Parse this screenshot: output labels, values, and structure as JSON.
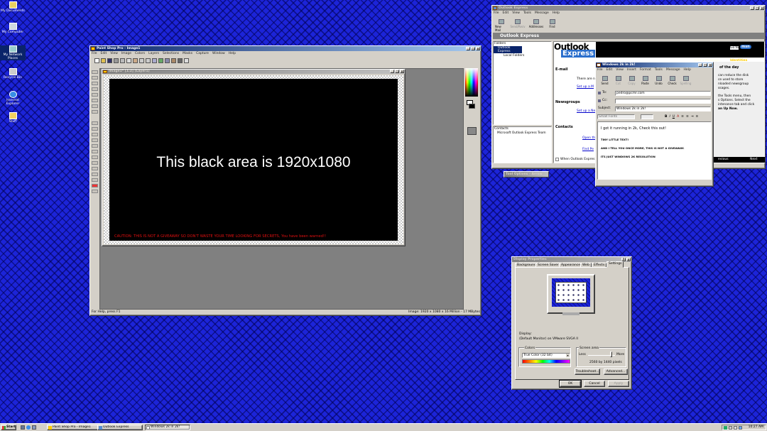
{
  "desktop": {
    "icons": [
      "My Documents",
      "My Computer",
      "My Network Places",
      "Recycle Bin",
      "Internet Explorer",
      "Stuff"
    ]
  },
  "psp": {
    "title": "Paint Shop Pro - Image1",
    "menu": [
      "File",
      "Edit",
      "View",
      "Image",
      "Colors",
      "Layers",
      "Selections",
      "Masks",
      "Capture",
      "Window",
      "Help"
    ],
    "doc_title": "Image1* [1:2] (Layer1)",
    "canvas_text": "This black area is 1920x1080",
    "warning": "CAUTION: THIS IS NOT A GIVEAWAY SO DON'T WASTE YOUR TIME LOOKING FOR SECRETS, You have been warned!!",
    "status_left": "For Help, press F1",
    "status_right": "Image: 1920 x 1080 x 16 Million - 17 MBytes"
  },
  "oe": {
    "title": "Outlook Express",
    "menu": [
      "File",
      "Edit",
      "View",
      "Tools",
      "Message",
      "Help"
    ],
    "toolbar": [
      "New Mail",
      "Send/Recv",
      "Addresses",
      "Find"
    ],
    "header": "Outlook Express",
    "folders_label": "Folders",
    "folders": [
      "Outlook Express",
      "Local Folders"
    ],
    "contacts_label": "Contacts",
    "contacts": [
      "Microsoft Outlook Express Team"
    ],
    "logo1": "Outlook",
    "logo2": "Express",
    "goto": "Go to",
    "msn": "msn",
    "email_h": "E-mail",
    "email_1": "There are n",
    "email_2": "Set up a M",
    "news_h": "Newsgroups",
    "news_1": "Set up a Ne",
    "contacts_h": "Contacts",
    "contacts_1": "Open th",
    "contacts_2": "Find Pe",
    "startup": "When Outlook Expres",
    "find_msg": "Find a Message...",
    "identities": "Identities",
    "tip_title": "of the day",
    "tip_lines": [
      "can reduce the disk",
      "ce used to store",
      "nloaded newsgroup",
      "ssages.",
      "the Tools menu, then",
      "s Options. Select the",
      "intenance tab and click",
      "an Up Now."
    ],
    "prev": "evious",
    "next": "Next"
  },
  "compose": {
    "title": "Windows 2k in 2k!",
    "menu": [
      "File",
      "Edit",
      "View",
      "Insert",
      "Format",
      "Tools",
      "Message",
      "Help"
    ],
    "toolbar": [
      "Send",
      "Cut",
      "Copy",
      "Paste",
      "Undo",
      "Check",
      "Spelling"
    ],
    "to_label": "To:",
    "to": "pedro@pcmr.com",
    "cc_label": "Cc:",
    "cc": "",
    "subject_label": "Subject:",
    "subject": "Windows 2k in 2k!",
    "font": "Small Fonts",
    "body": [
      "I got it running in 2k, Check this out!",
      "TINY LITTLE TEXT!",
      "AND I TELL YOU ONCE MORE, THIS IS NOT A GIVEAWAY.",
      "ITS JUST WINDOWS 2K RESOLUTION"
    ]
  },
  "mini_title": "Tool Options - Arrow",
  "display": {
    "title": "Display Properties",
    "tabs": [
      "Background",
      "Screen Saver",
      "Appearance",
      "Web",
      "Effects",
      "Settings"
    ],
    "display_label": "Display:",
    "display_value": "(Default Monitor) on VMware SVGA II",
    "colors_label": "Colors",
    "colors_value": "True Color (32 bit)",
    "area_label": "Screen area",
    "less": "Less",
    "more": "More",
    "resolution": "2560 by 1440 pixels",
    "troubleshoot": "Troubleshoot...",
    "advanced": "Advanced...",
    "ok": "OK",
    "cancel": "Cancel",
    "apply": "Apply",
    "palette": [
      "#ff0000",
      "#ff7f00",
      "#ffff00",
      "#00ff00",
      "#00ffff",
      "#0000ff",
      "#8b00ff",
      "#ff00ff"
    ]
  },
  "taskbar": {
    "start": "Start",
    "tasks": [
      "Paint Shop Pro - Image1",
      "Outlook Express",
      "Windows 2k in 2k!"
    ],
    "clock": "10:27 AM"
  }
}
